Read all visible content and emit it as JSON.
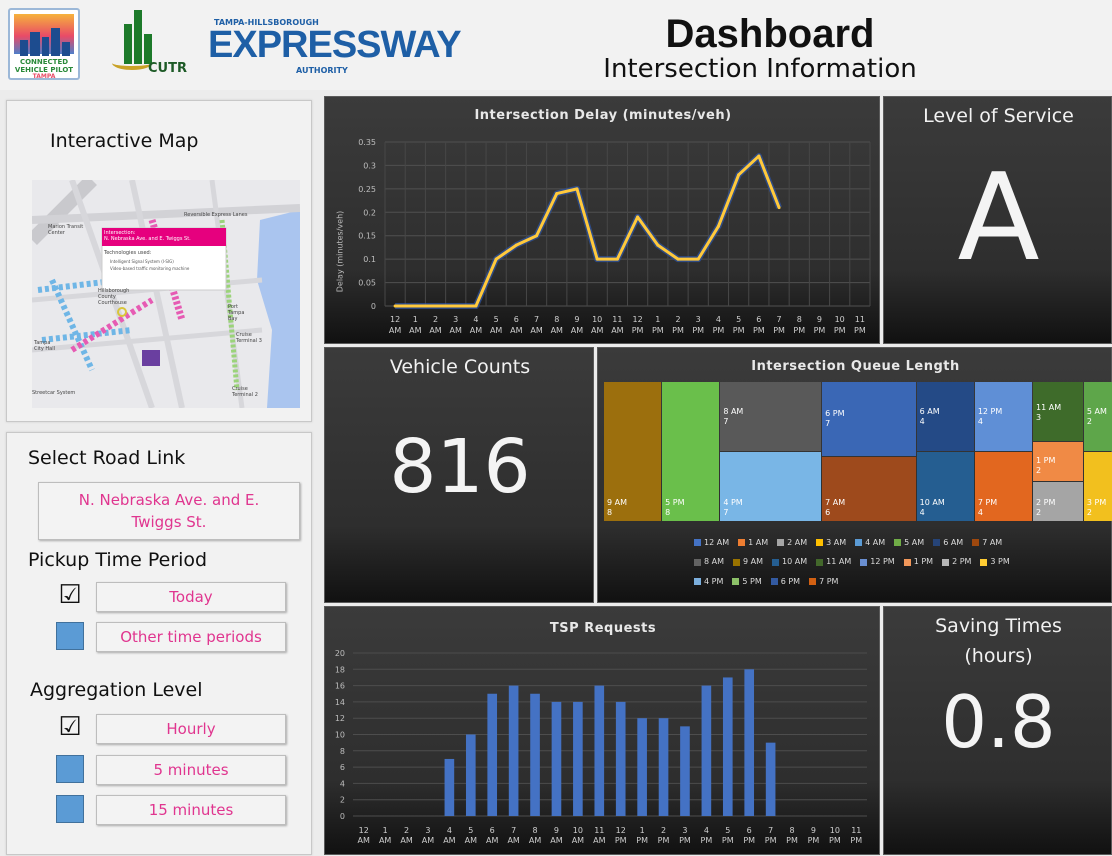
{
  "header": {
    "title": "Dashboard",
    "subtitle": "Intersection Information",
    "logos": {
      "cvp": [
        "CONNECTED",
        "VEHICLE PILOT",
        "TAMPA"
      ],
      "cutr": "CUTR",
      "expressway": {
        "top": "TAMPA-HILLSBOROUGH",
        "main": "EXPRESSWAY",
        "bottom": "AUTHORITY"
      }
    }
  },
  "left": {
    "map_title": "Interactive Map",
    "map": {
      "popup_title": "Intersection:\nN. Nebraska Ave. and E. Twiggs St.",
      "popup_sub": "Technologies used:",
      "popup_items": [
        "Intelligent Signal System (I-SIG)",
        "Video-based traffic monitoring machine"
      ],
      "labels": [
        "Marion Transit Center",
        "Reversible Express Lanes",
        "Hillsborough County Courthouse",
        "Port Tampa Bay",
        "Cruise Terminal 3",
        "Tampa City Hall",
        "Streetcar System",
        "Cruise Terminal 2"
      ]
    },
    "road_link_label": "Select Road Link",
    "road_link_value": "N. Nebraska Ave. and E. Twiggs St.",
    "pickup_label": "Pickup Time Period",
    "pickup_options": [
      {
        "label": "Today",
        "checked": true
      },
      {
        "label": "Other time periods",
        "checked": false
      }
    ],
    "aggregation_label": "Aggregation Level",
    "aggregation_options": [
      {
        "label": "Hourly",
        "checked": true
      },
      {
        "label": "5 minutes",
        "checked": false
      },
      {
        "label": "15 minutes",
        "checked": false
      }
    ],
    "check_glyph": "☑"
  },
  "tiles": {
    "los_title": "Level of Service",
    "los_value": "A",
    "vc_title": "Vehicle Counts",
    "vc_value": "816",
    "saving_title": "Saving Times\n(hours)",
    "saving_value": "0.8"
  },
  "colors": {
    "line": "#ffc93c",
    "bar": "#4472c4",
    "pink": "#e0358f",
    "checkbox_blue": "#5b9bd5"
  },
  "chart_data": [
    {
      "id": "delay",
      "type": "line",
      "title": "Intersection Delay (minutes/veh)",
      "ylabel": "Delay (minutes/veh)",
      "ylim": [
        0,
        0.35
      ],
      "yticks": [
        "0",
        "0.05",
        "0.1",
        "0.15",
        "0.2",
        "0.25",
        "0.3",
        "0.35"
      ],
      "categories": [
        [
          "12",
          "AM"
        ],
        [
          "1",
          "AM"
        ],
        [
          "2",
          "AM"
        ],
        [
          "3",
          "AM"
        ],
        [
          "4",
          "AM"
        ],
        [
          "5",
          "AM"
        ],
        [
          "6",
          "AM"
        ],
        [
          "7",
          "AM"
        ],
        [
          "8",
          "AM"
        ],
        [
          "9",
          "AM"
        ],
        [
          "10",
          "AM"
        ],
        [
          "11",
          "AM"
        ],
        [
          "12",
          "PM"
        ],
        [
          "1",
          "PM"
        ],
        [
          "2",
          "PM"
        ],
        [
          "3",
          "PM"
        ],
        [
          "4",
          "PM"
        ],
        [
          "5",
          "PM"
        ],
        [
          "6",
          "PM"
        ],
        [
          "7",
          "PM"
        ],
        [
          "8",
          "PM"
        ],
        [
          "9",
          "PM"
        ],
        [
          "10",
          "PM"
        ],
        [
          "11",
          "PM"
        ]
      ],
      "values": [
        0,
        0,
        0,
        0,
        0,
        0.1,
        0.13,
        0.15,
        0.24,
        0.25,
        0.1,
        0.1,
        0.19,
        0.13,
        0.1,
        0.1,
        0.17,
        0.28,
        0.32,
        0.21
      ],
      "grid": true
    },
    {
      "id": "queue",
      "type": "treemap",
      "title": "Intersection Queue Length",
      "items": [
        {
          "label": "9 AM",
          "value": 8,
          "color": "#9c6f0d"
        },
        {
          "label": "5 PM",
          "value": 8,
          "color": "#6abf4b"
        },
        {
          "label": "8 AM",
          "value": 7,
          "color": "#595959"
        },
        {
          "label": "4 PM",
          "value": 7,
          "color": "#79b6e6"
        },
        {
          "label": "6 PM",
          "value": 7,
          "color": "#3a67b5"
        },
        {
          "label": "7 AM",
          "value": 6,
          "color": "#9e4a1c"
        },
        {
          "label": "6 AM",
          "value": 4,
          "color": "#244a86"
        },
        {
          "label": "10 AM",
          "value": 4,
          "color": "#255e91"
        },
        {
          "label": "12 PM",
          "value": 4,
          "color": "#5f8fd6"
        },
        {
          "label": "7 PM",
          "value": 4,
          "color": "#e2671f"
        },
        {
          "label": "11 AM",
          "value": 3,
          "color": "#3e6b2a"
        },
        {
          "label": "5 AM",
          "value": 2,
          "color": "#5ea64a"
        },
        {
          "label": "1 PM",
          "value": 2,
          "color": "#f08a45"
        },
        {
          "label": "2 PM",
          "value": 2,
          "color": "#a5a5a5"
        },
        {
          "label": "3 PM",
          "value": 2,
          "color": "#f2c01e"
        }
      ],
      "legend": [
        [
          "12 AM",
          "#4472c4"
        ],
        [
          "1 AM",
          "#ed7d31"
        ],
        [
          "2 AM",
          "#a5a5a5"
        ],
        [
          "3 AM",
          "#ffc000"
        ],
        [
          "4 AM",
          "#5b9bd5"
        ],
        [
          "5 AM",
          "#70ad47"
        ],
        [
          "6 AM",
          "#264478"
        ],
        [
          "7 AM",
          "#9e480e"
        ],
        [
          "8 AM",
          "#636363"
        ],
        [
          "9 AM",
          "#997300"
        ],
        [
          "10 AM",
          "#255e91"
        ],
        [
          "11 AM",
          "#43682b"
        ],
        [
          "12 PM",
          "#698ed0"
        ],
        [
          "1 PM",
          "#f1975a"
        ],
        [
          "2 PM",
          "#b7b7b7"
        ],
        [
          "3 PM",
          "#ffcd33"
        ],
        [
          "4 PM",
          "#7cafdd"
        ],
        [
          "5 PM",
          "#8cc168"
        ],
        [
          "6 PM",
          "#335aa1"
        ],
        [
          "7 PM",
          "#d26012"
        ]
      ]
    },
    {
      "id": "tsp",
      "type": "bar",
      "title": "TSP Requests",
      "ylim": [
        0,
        20
      ],
      "yticks": [
        "0",
        "2",
        "4",
        "6",
        "8",
        "10",
        "12",
        "14",
        "16",
        "18",
        "20"
      ],
      "categories": [
        [
          "12",
          "AM"
        ],
        [
          "1",
          "AM"
        ],
        [
          "2",
          "AM"
        ],
        [
          "3",
          "AM"
        ],
        [
          "4",
          "AM"
        ],
        [
          "5",
          "AM"
        ],
        [
          "6",
          "AM"
        ],
        [
          "7",
          "AM"
        ],
        [
          "8",
          "AM"
        ],
        [
          "9",
          "AM"
        ],
        [
          "10",
          "AM"
        ],
        [
          "11",
          "AM"
        ],
        [
          "12",
          "PM"
        ],
        [
          "1",
          "PM"
        ],
        [
          "2",
          "PM"
        ],
        [
          "3",
          "PM"
        ],
        [
          "4",
          "PM"
        ],
        [
          "5",
          "PM"
        ],
        [
          "6",
          "PM"
        ],
        [
          "7",
          "PM"
        ],
        [
          "8",
          "PM"
        ],
        [
          "9",
          "PM"
        ],
        [
          "10",
          "PM"
        ],
        [
          "11",
          "PM"
        ]
      ],
      "values": [
        0,
        0,
        0,
        0,
        7,
        10,
        15,
        16,
        15,
        14,
        14,
        16,
        14,
        12,
        12,
        11,
        16,
        17,
        18,
        9,
        0,
        0,
        0,
        0
      ],
      "grid": true
    }
  ]
}
